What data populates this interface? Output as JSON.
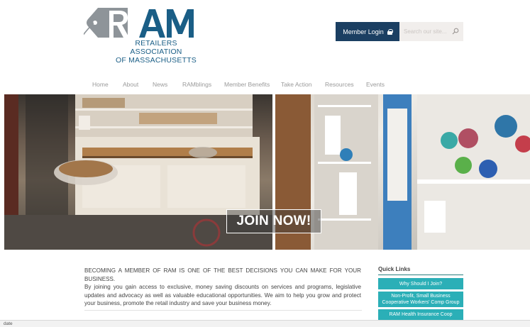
{
  "brand": {
    "logo_text": "RAM",
    "name_line1": "RETAILERS ASSOCIATION",
    "name_line2": "OF MASSACHUSETTS",
    "colors": {
      "navy": "#1b3f62",
      "blue": "#1a5e86",
      "gray_tag": "#8e9499",
      "teal": "#2bafb7"
    }
  },
  "header": {
    "login_label": "Member Login",
    "login_icon": "lock-icon",
    "search_placeholder": "Search our site...",
    "search_icon": "search-icon"
  },
  "nav": {
    "items": [
      {
        "label": "Home"
      },
      {
        "label": "About"
      },
      {
        "label": "News"
      },
      {
        "label": "RAMblings"
      },
      {
        "label": "Member Benefits"
      },
      {
        "label": "Take Action"
      },
      {
        "label": "Resources"
      },
      {
        "label": "Events"
      }
    ]
  },
  "hero": {
    "cta_label": "JOIN NOW!"
  },
  "intro": {
    "heading": "BECOMING A MEMBER OF RAM IS ONE OF THE BEST DECISIONS YOU CAN MAKE FOR YOUR BUSINESS.",
    "body": "By joining you gain access to exclusive, money saving discounts on services and programs, legislative updates and advocacy as well as valuable educational opportunities. We aim to help you grow and protect your business, promote the retail industry and save your business money."
  },
  "quick_links": {
    "title": "Quick Links",
    "items": [
      {
        "label": "Why Should I Join?"
      },
      {
        "label": "Non-Profit, Small Business Cooperative Workers' Comp Group"
      },
      {
        "label": "RAM Health Insurance Coop"
      }
    ]
  },
  "status_bar": {
    "text": "date"
  }
}
